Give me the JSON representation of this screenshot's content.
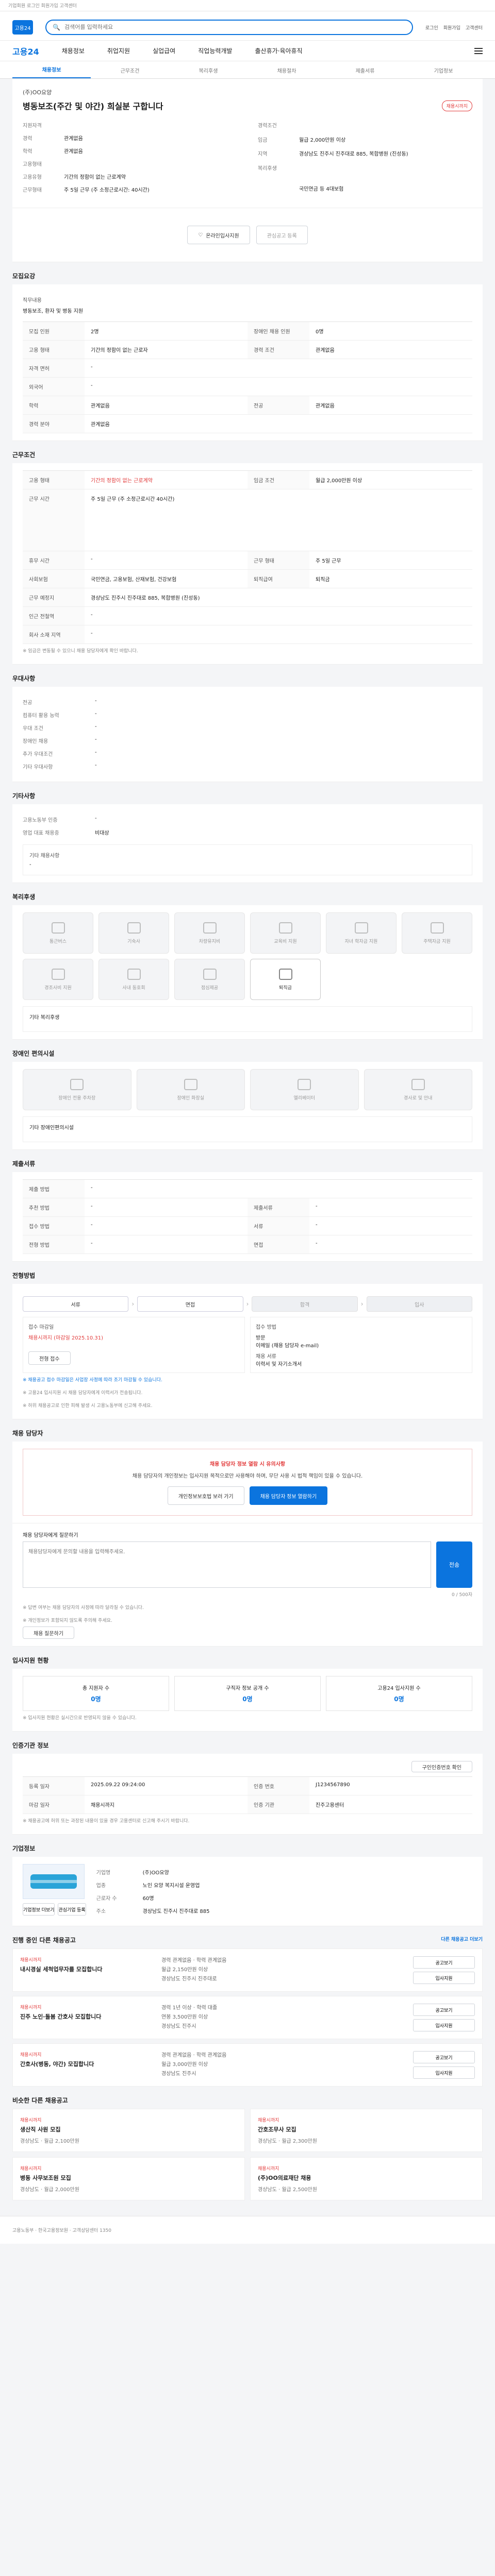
{
  "topbar": {
    "text": "기업회원 로그인 회원가입 고객센터"
  },
  "header": {
    "logo": "고용24",
    "search_placeholder": "검색어를 입력하세요",
    "links": [
      "로그인",
      "회원가입",
      "고객센터"
    ]
  },
  "gnb": {
    "brand": "고용24",
    "items": [
      "채용정보",
      "취업지원",
      "실업급여",
      "직업능력개발",
      "출산휴가·육아휴직"
    ]
  },
  "crumbs": [
    "채용정보",
    "근무조건",
    "복리후생",
    "채용절차",
    "제출서류",
    "기업정보"
  ],
  "job": {
    "company": "(주)OO요양",
    "title": "병동보조(주간 및 야간) 희실분 구합니다",
    "badge": "채용시까지",
    "left": [
      {
        "k": "지원자격",
        "v": ""
      },
      {
        "k": "경력",
        "v": "관계없음"
      },
      {
        "k": "학력",
        "v": "관계없음"
      },
      {
        "k": "고용형태",
        "v": ""
      },
      {
        "k": "고용유형",
        "v": "기간의 정함이 없는 근로계약"
      },
      {
        "k": "근무형태",
        "v": "주 5일 근무 (주 소정근로시간: 40시간)"
      }
    ],
    "right": [
      {
        "k": "경력조건",
        "v": ""
      },
      {
        "k": "임금",
        "v": "월급 2,000만원 이상"
      },
      {
        "k": "지역",
        "v": "경상남도 진주시 진주대로 885, 복합병원 (진성동)"
      },
      {
        "k": "복리후생",
        "v": ""
      },
      {
        "k": "",
        "v": ""
      },
      {
        "k": "",
        "v": "국민연금 등 4대보험"
      }
    ]
  },
  "apply": {
    "primary": "온라인입사지원",
    "secondary": "관심공고 등록",
    "tertiary": "지원하기"
  },
  "recruit_section": {
    "title": "모집요강",
    "desc_title": "직무내용",
    "desc": "병동보조, 환자 및 병동 지원",
    "rows": [
      [
        "모집 인원",
        "2명",
        "장애인 채용 인원",
        "0명"
      ],
      [
        "고용 형태",
        "기간의 정함이 없는 근로자",
        "경력 조건",
        "관계없음"
      ],
      [
        "자격 면허",
        "-",
        "",
        ""
      ],
      [
        "외국어",
        "-",
        "",
        ""
      ],
      [
        "학력",
        "관계없음",
        "전공",
        "관계없음"
      ],
      [
        "경력 분야",
        "관계없음",
        "",
        ""
      ]
    ]
  },
  "conditions": {
    "title": "근무조건",
    "rows": [
      [
        "고용 형태",
        "기간의 정함이 없는 근로계약",
        "임금 조건",
        "월급 2,000만원 이상"
      ],
      [
        "근무 시간",
        "주 5일 근무 (주 소정근로시간 40시간)",
        "",
        ""
      ],
      [
        "휴무 시간",
        "-",
        "근무 형태",
        "주 5일 근무"
      ],
      [
        "사회보험",
        "국민연금, 고용보험, 산재보험, 건강보험",
        "퇴직급여",
        "퇴직금"
      ],
      [
        "근무 예정지",
        "경상남도 진주시 진주대로 885, 복합병원 (진성동)",
        "",
        ""
      ],
      [
        "인근 전철역",
        "-",
        "",
        ""
      ],
      [
        "회사 소재 지역",
        "-",
        "",
        ""
      ]
    ],
    "note": "※ 임금은 변동될 수 있으니 채용 담당자에게 확인 바랍니다."
  },
  "etc_section": {
    "title": "우대사항",
    "rows": [
      [
        "전공",
        "-"
      ],
      [
        "컴퓨터 활용 능력",
        "-"
      ],
      [
        "우대 조건",
        "-"
      ],
      [
        "장애인 채용",
        "-"
      ],
      [
        "추가 우대조건",
        "-"
      ],
      [
        "기타 우대사항",
        "-"
      ]
    ]
  },
  "other_section": {
    "title": "기타사항",
    "rows": [
      [
        "고용노동부 인증",
        "-"
      ],
      [
        "영업 대표 채용중",
        "비대상"
      ]
    ],
    "extra_title": "기타 채용사항",
    "extra": "-"
  },
  "welfare": {
    "title": "복리후생",
    "tiles": [
      "통근버스",
      "기숙사",
      "차량유지비",
      "교육비 지원",
      "자녀 학자금 지원",
      "주택자금 지원",
      "경조사비 지원",
      "사내 동호회",
      "점심제공",
      "퇴직금"
    ],
    "on": [
      9
    ],
    "other_title": "기타 복리후생"
  },
  "disability": {
    "title": "장애인 편의시설",
    "tiles": [
      "장애인 전용 주차장",
      "장애인 화장실",
      "엘리베이터",
      "경사로 및 안내"
    ],
    "other_title": "기타 장애인편의시설"
  },
  "docs": {
    "title": "제출서류",
    "rows": [
      [
        "제출 방법",
        "-"
      ],
      [
        "추천 방법",
        "-",
        "제출서류",
        "-"
      ],
      [
        "접수 방법",
        "-",
        "서류",
        "-"
      ],
      [
        "전형 방법",
        "-",
        "면접",
        "-"
      ]
    ]
  },
  "process": {
    "title": "전형방법",
    "steps": [
      "서류",
      "면접",
      "합격",
      "입사"
    ],
    "left_title": "접수 마감일",
    "left_value": "채용시까지 (마감일 2025.10.31)",
    "left_btn": "전형 접수",
    "right_title": "접수 방법",
    "right_lines": [
      "방문",
      "이메일 (채용 담당자 e-mail)",
      "채용 서류",
      "이력서 및 자기소개서"
    ],
    "notes": [
      "※ 채용공고 접수 마감일은 사업장 사정에 따라 조기 마감될 수 있습니다.",
      "※ 고용24 입사지원 시 채용 담당자에게 이력서가 전송됩니다.",
      "※ 허위 채용공고로 인한 피해 발생 시 고용노동부에 신고해 주세요."
    ]
  },
  "contact": {
    "title": "채용 담당자",
    "notice_title": "채용 담당자 정보 열람 시 유의사항",
    "notice_body": "채용 담당자의 개인정보는 입사지원 목적으로만 사용해야 하며, 무단 사용 시 법적 책임이 있을 수 있습니다.",
    "btn_left": "개인정보보호법 보러 가기",
    "btn_right": "채용 담당자 정보 열람하기"
  },
  "qa": {
    "title": "채용 담당자에게 질문하기",
    "placeholder": "채용담당자에게 문의할 내용을 입력해주세요.",
    "counter": "0 / 500자",
    "send": "전송",
    "notes": [
      "※ 답변 여부는 채용 담당자의 사정에 따라 달라질 수 있습니다.",
      "※ 개인정보가 포함되지 않도록 주의해 주세요."
    ],
    "btn": "채용 질문하기"
  },
  "status": {
    "title": "입사지원 현황",
    "stats": [
      {
        "label": "총 지원자 수",
        "value": "0명"
      },
      {
        "label": "구직자 정보 공개 수",
        "value": "0명"
      },
      {
        "label": "고용24 입사지원 수",
        "value": "0명"
      }
    ],
    "note": "※ 입사지원 현황은 실시간으로 반영되지 않을 수 있습니다."
  },
  "info": {
    "title": "인증기관 정보",
    "btn": "구인인증번호 확인",
    "rows": [
      [
        "등록 일자",
        "2025.09.22 09:24:00",
        "인증 번호",
        "J1234567890"
      ],
      [
        "마감 일자",
        "채용시까지",
        "인증 기관",
        "진주고용센터"
      ]
    ],
    "note": "※ 채용공고에 허위 또는 과장된 내용이 있을 경우 고용센터로 신고해 주시기 바랍니다."
  },
  "company": {
    "title": "기업정보",
    "rows": [
      [
        "기업명",
        "(주)OO요양"
      ],
      [
        "업종",
        "노인 요양 복지시설 운영업"
      ],
      [
        "근로자 수",
        "60명"
      ],
      [
        "주소",
        "경상남도 진주시 진주대로 885"
      ]
    ],
    "btns": [
      "기업정보 더보기",
      "관심기업 등록"
    ]
  },
  "other_jobs": {
    "title": "진행 중인 다른 채용공고",
    "link": "다른 채용공고 더보기",
    "items": [
      {
        "tag": "채용시까지",
        "name": "내시경실 세척업무자를 모집합니다",
        "meta": [
          "경력 관계없음 · 학력 관계없음",
          "월급 2,150만원 이상",
          "경상남도 진주시 진주대로"
        ]
      },
      {
        "tag": "채용시까지",
        "name": "진주 노인·돌봄 간호사 모집합니다",
        "meta": [
          "경력 1년 이상 · 학력 대졸",
          "연봉 3,500만원 이상",
          "경상남도 진주시"
        ]
      },
      {
        "tag": "채용시까지",
        "name": "간호사(병동, 야간) 모집합니다",
        "meta": [
          "경력 관계없음 · 학력 관계없음",
          "월급 3,000만원 이상",
          "경상남도 진주시"
        ]
      }
    ],
    "btns": [
      "공고보기",
      "입사지원"
    ]
  },
  "recommend": {
    "title": "비슷한 다른 채용공고",
    "items": [
      {
        "tag": "채용시까지",
        "name": "생산직 사원 모집",
        "meta": "경상남도 · 월급 2,100만원"
      },
      {
        "tag": "채용시까지",
        "name": "간호조무사 모집",
        "meta": "경상남도 · 월급 2,300만원"
      },
      {
        "tag": "채용시까지",
        "name": "병동 사무보조원 모집",
        "meta": "경상남도 · 월급 2,000만원"
      },
      {
        "tag": "채용시까지",
        "name": "(주)OO의료재단 채용",
        "meta": "경상남도 · 월급 2,500만원"
      }
    ]
  },
  "footer": {
    "text": "고용노동부 · 한국고용정보원 · 고객상담센터 1350"
  }
}
